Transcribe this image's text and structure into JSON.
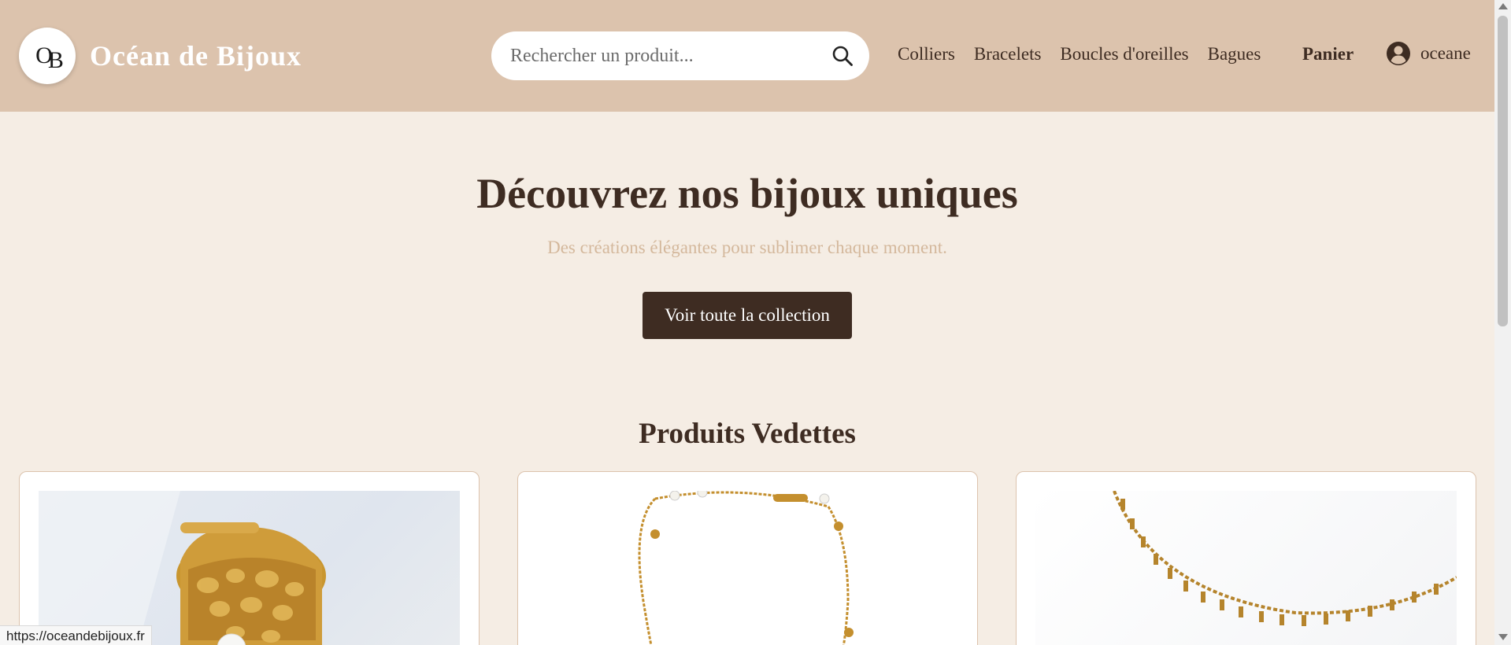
{
  "header": {
    "logo_text_top": "O",
    "logo_text_bottom": "B",
    "brand": "Océan de Bijoux",
    "search_placeholder": "Rechercher un produit...",
    "search_value": "",
    "search_icon": "search-icon",
    "nav": [
      {
        "label": "Colliers"
      },
      {
        "label": "Bracelets"
      },
      {
        "label": "Boucles d'oreilles"
      },
      {
        "label": "Bagues"
      }
    ],
    "cart_label": "Panier",
    "user_icon": "user-circle-icon",
    "username": "oceane"
  },
  "hero": {
    "title": "Découvrez nos bijoux uniques",
    "subtitle": "Des créations élégantes pour sublimer chaque moment.",
    "cta": "Voir toute la collection"
  },
  "featured": {
    "title": "Produits Vedettes",
    "products": [
      {
        "image": "gold-hammered-ring-with-pearl"
      },
      {
        "image": "gold-chain-bracelet-with-beads"
      },
      {
        "image": "gold-chain-necklace-with-pendants"
      }
    ]
  },
  "status_bar": {
    "url": "https://oceandebijoux.fr"
  },
  "colors": {
    "header_bg": "#dcc3ad",
    "page_bg": "#f5ede4",
    "text_dark": "#3e2c22",
    "subtitle": "#d4b89c",
    "button_bg": "#3e2c22"
  }
}
